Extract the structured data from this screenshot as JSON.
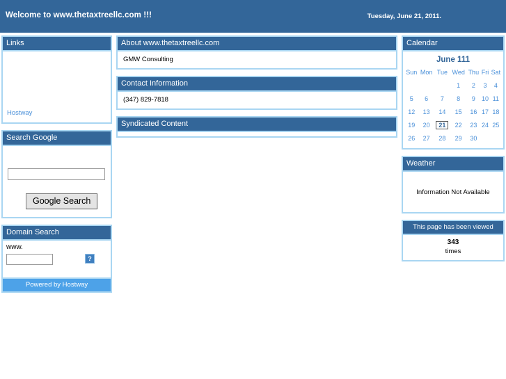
{
  "banner": {
    "title": "Welcome to www.thetaxtreellc.com !!!",
    "date": "Tuesday, June 21, 2011."
  },
  "colors": {
    "header_blue": "#336699",
    "border_blue": "#a9d6f2",
    "link_blue": "#4a90d9",
    "footer_blue": "#4da2e8"
  },
  "left": {
    "links_panel": {
      "title": "Links",
      "items": [
        {
          "label": "Hostway"
        }
      ]
    },
    "google_panel": {
      "title": "Search Google",
      "input_value": "",
      "input_placeholder": "",
      "button_label": "Google Search"
    },
    "domain_panel": {
      "title": "Domain Search",
      "prefix_label": "www.",
      "input_value": "",
      "input_placeholder": "",
      "submit_icon": "broken-image-icon",
      "submit_glyph": "?"
    },
    "footer": {
      "label": "Powered by Hostway"
    }
  },
  "main": {
    "about_panel": {
      "title": "About www.thetaxtreellc.com",
      "body": "GMW Consulting"
    },
    "contact_panel": {
      "title": "Contact Information",
      "body": "(347) 829-7818"
    },
    "syndicated_panel": {
      "title": "Syndicated Content",
      "body": ""
    }
  },
  "right": {
    "calendar_panel": {
      "title": "Calendar",
      "month_label": "June 111",
      "weekdays": [
        "Sun",
        "Mon",
        "Tue",
        "Wed",
        "Thu",
        "Fri",
        "Sat"
      ],
      "weeks": [
        [
          "",
          "",
          "",
          "1",
          "2",
          "3",
          "4"
        ],
        [
          "5",
          "6",
          "7",
          "8",
          "9",
          "10",
          "11"
        ],
        [
          "12",
          "13",
          "14",
          "15",
          "16",
          "17",
          "18"
        ],
        [
          "19",
          "20",
          "21",
          "22",
          "23",
          "24",
          "25"
        ],
        [
          "26",
          "27",
          "28",
          "29",
          "30",
          "",
          ""
        ]
      ],
      "today": "21"
    },
    "weather_panel": {
      "title": "Weather",
      "message": "Information Not Available"
    },
    "counter_panel": {
      "title": "This page has been viewed",
      "count": "343",
      "unit": "times"
    }
  }
}
